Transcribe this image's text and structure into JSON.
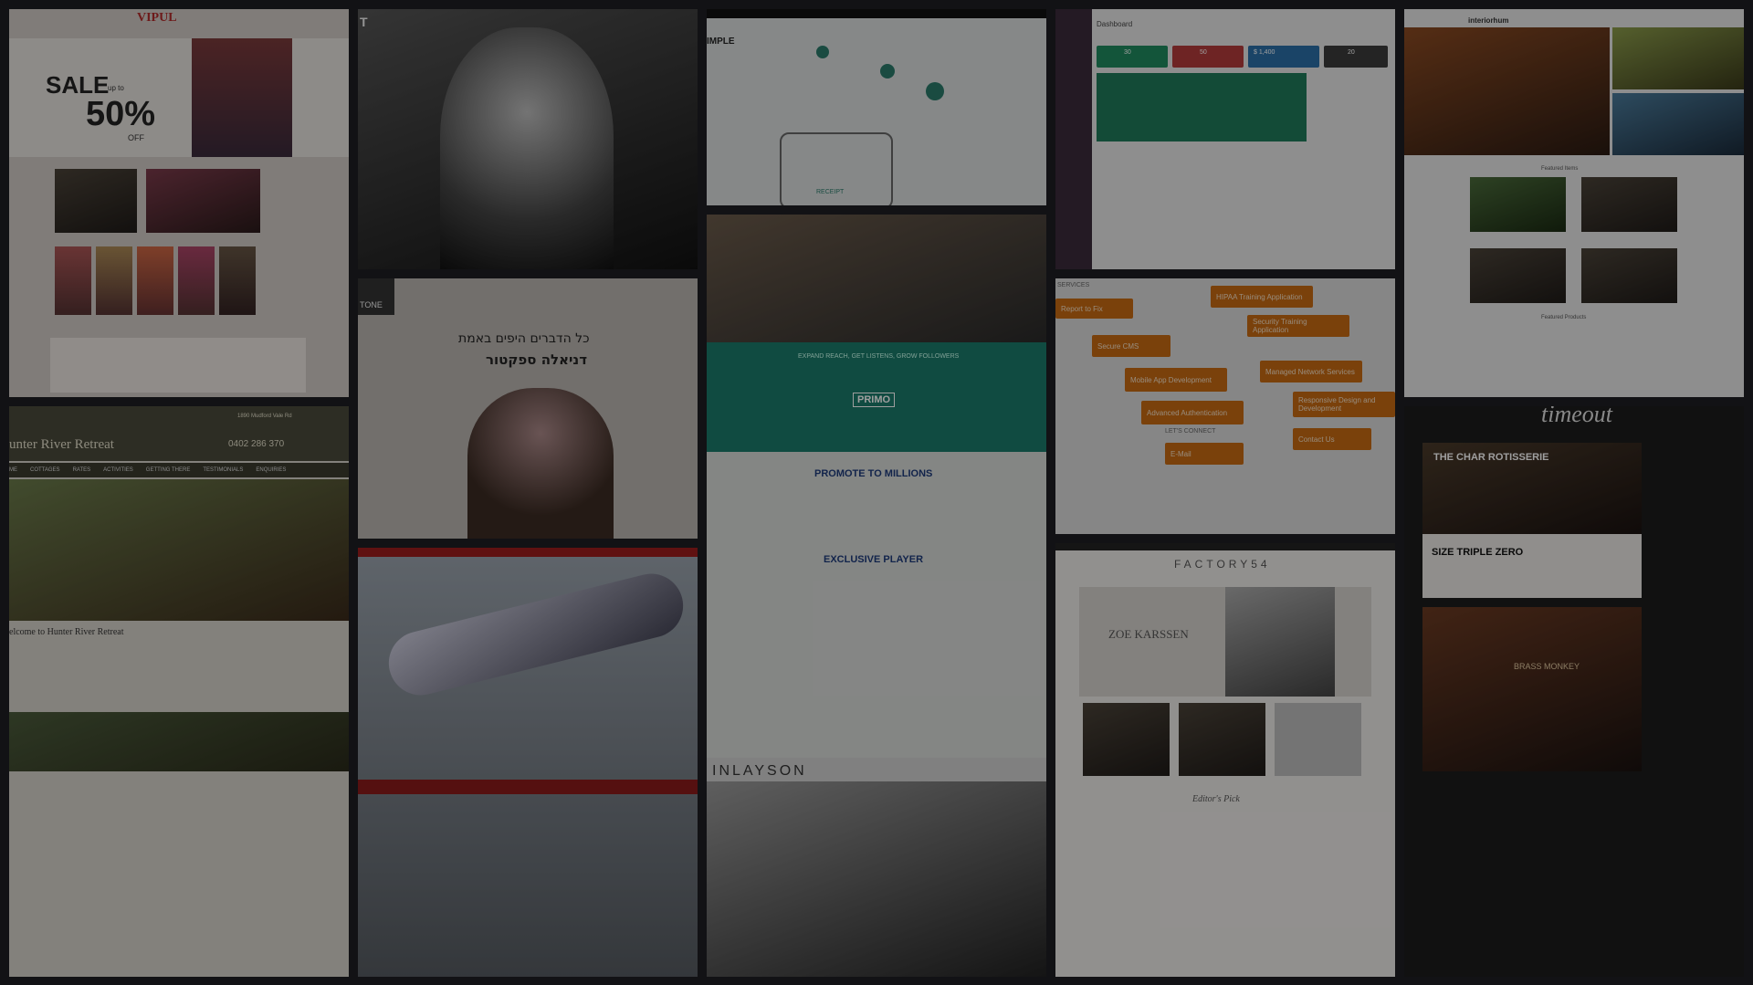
{
  "tiles": {
    "vipul": {
      "logo": "VIPUL",
      "sale_text": "SALE",
      "sale_upto": "up to",
      "sale_percent": "50%",
      "sale_off": "OFF",
      "bg_color": "#d9d4cf"
    },
    "portrait1": {
      "letter": "T"
    },
    "simple": {
      "title": "IMPLE",
      "receipt": "RECEIPT"
    },
    "dashboard": {
      "title": "Dashboard",
      "stats": [
        {
          "value": "30",
          "color": "#1f8a5e"
        },
        {
          "value": "50",
          "color": "#b23a3a"
        },
        {
          "value": "$ 1,400",
          "color": "#2a6ea6"
        },
        {
          "value": "20",
          "color": "#3a3a3a"
        }
      ]
    },
    "interior": {
      "logo": "interiorhum",
      "featured": "Featured Items",
      "products": "Featured Products"
    },
    "hebrew": {
      "badge": "TONE",
      "line1": "כל הדברים היפים באמת",
      "line2": "דניאלה ספקטור"
    },
    "primo": {
      "headline": "EXPAND REACH, GET LISTENS, GROW FOLLOWERS",
      "logo": "PRIMO",
      "promote": "PROMOTE TO MILLIONS",
      "exclusive": "EXCLUSIVE PLAYER"
    },
    "services": {
      "heading_services": "SERVICES",
      "heading_contact": "LET'S CONNECT",
      "items": [
        "Report to Fix",
        "HIPAA Training Application",
        "Security Training Application",
        "Secure CMS",
        "Mobile App Development",
        "Managed Network Services",
        "Responsive Design and Development",
        "Advanced Authentication",
        "Contact Us",
        "E-Mail"
      ]
    },
    "hunter": {
      "title": "unter River Retreat",
      "phone": "0402 286 370",
      "address": "1890 Mudford Vale Rd",
      "nav": [
        "ME",
        "COTTAGES",
        "RATES",
        "ACTIVITIES",
        "GETTING THERE",
        "TESTIMONIALS",
        "ENQUIRIES"
      ],
      "welcome": "elcome to Hunter River Retreat"
    },
    "plane": {},
    "inlayson": {
      "title": "INLAYSON"
    },
    "factory": {
      "title": "FACTORY54",
      "model": "ZOE KARSSEN",
      "editor": "Editor's Pick"
    },
    "timeout": {
      "logo": "timeout",
      "headline1": "THE CHAR ROTISSERIE",
      "headline2": "SIZE TRIPLE ZERO",
      "feature": "BRASS MONKEY"
    }
  },
  "overlay_color": "#000000"
}
